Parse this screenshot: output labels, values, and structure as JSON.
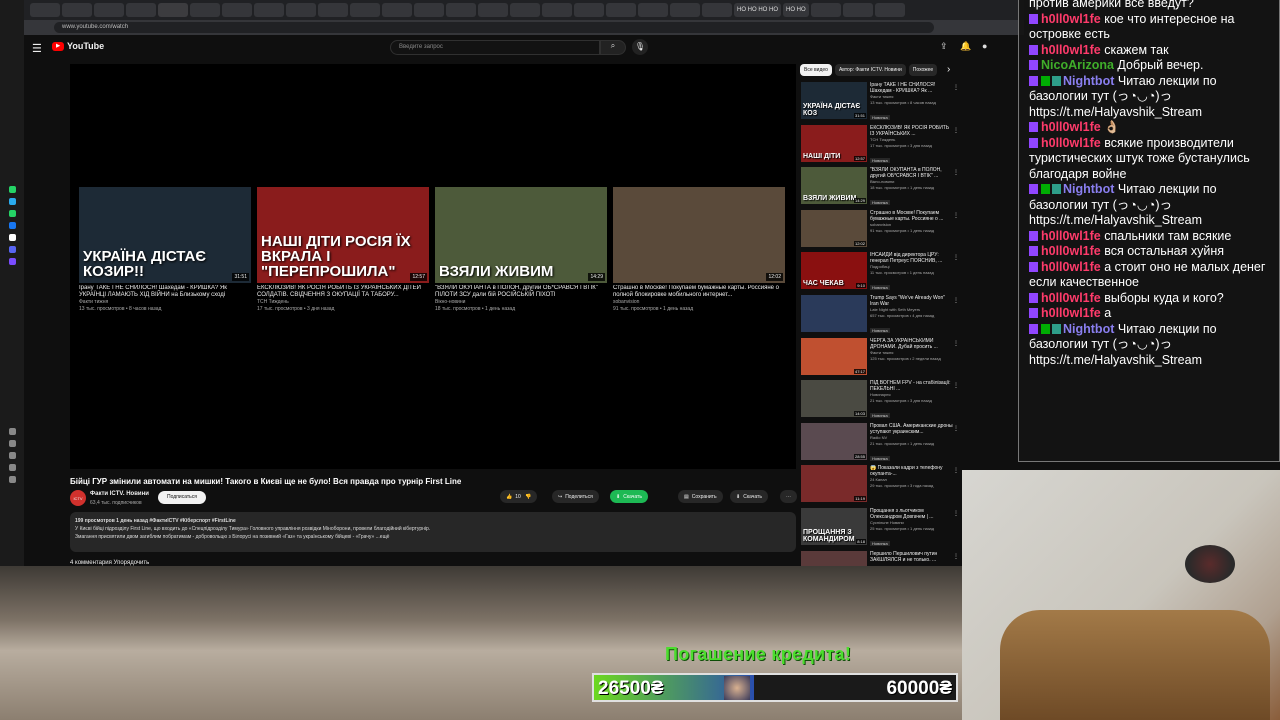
{
  "colors": {
    "bg": "#0f0f0f",
    "accent_red": "#ff0000",
    "chat_purple": "#9146ff",
    "credit_green": "#4cdd2e"
  },
  "browser": {
    "tabs": [
      "",
      "",
      "",
      "",
      "",
      "",
      "",
      "",
      "",
      "",
      "",
      "",
      "",
      "",
      "",
      "",
      "",
      "",
      "",
      "",
      "",
      "",
      "НО НО НО НО",
      "НО НО",
      "",
      "",
      ""
    ],
    "url": "www.youtube.com/watch"
  },
  "youtube": {
    "logo": "YouTube",
    "search_placeholder": "Введите запрос",
    "player_recs": [
      {
        "big": "УКРАЇНА ДІСТАЄ КОЗИР!!",
        "duration": "31:51",
        "title": "Ірану ТАКЕ І НЕ СНИЛОСЯ! Шахедам - КРИШКА? Як УКРАЇНЦІ ЛАМАЮТЬ ХІД ВІЙНИ на Близькому сході",
        "channel": "Факти тижня",
        "meta": "13 тыс. просмотров • 8 часов назад",
        "color": "#1d2a36"
      },
      {
        "big": "НАШІ ДІТИ РОСІЯ ЇХ ВКРАЛА І \"ПЕРЕПРОШИЛА\"",
        "duration": "12:57",
        "title": "ЕКСКЛЮЗИВ! ЯК РОСІЯ РОБИТЬ ІЗ УКРАЇНСЬКИХ ДІТЕЙ СОЛДАТІВ. СВІДЧЕННЯ З ОКУПАЦІЇ ТА ТАБОРУ...",
        "channel": "ТСН Тиждень",
        "meta": "17 тыс. просмотров • 3 дня назад",
        "color": "#8a1c1c"
      },
      {
        "big": "ВЗЯЛИ ЖИВИМ",
        "duration": "14:29",
        "title": "\"ВЗЯЛИ ОКУПАНТА в ПОЛОН, другий ОБ*СРАВСЯ І ВТІК\" ПІЛОТИ ЗСУ дали бій РОСІЙСЬКІЙ ПІХОТІ",
        "channel": "Вікно-новини",
        "meta": "18 тыс. просмотров • 1 день назад",
        "color": "#4d5a3a"
      },
      {
        "big": "",
        "duration": "12:02",
        "title": "Страшно в Москве! Покупаем бумажные карты. Россияне о полной блокировке мобильного интернет...",
        "channel": "sobanvision",
        "meta": "91 тыс. просмотров • 1 день назад",
        "color": "#5a4a3a"
      }
    ],
    "video_title": "Бійці ГУР змінили автомати на мишки! Такого в Києві ще не було! Вся правда про турнір First Line",
    "channel_name": "Факти ICTV. Новини",
    "channel_subs": "63,4 тыс. подписчиков",
    "subscribe": "Подписаться",
    "likes": "10",
    "share": "Поделиться",
    "download_green": "Скачать",
    "save": "Сохранить",
    "download": "Скачать",
    "desc_lines": [
      "199 просмотров  1 день назад  #ФактиICTV #Кіберспорт #FirstLine",
      "У Києві бійці підрозділу First Line, що входить до «Спецпідрозділу Тимура» Головного управління розвідки Міноборони, провели благодійний кібертурнір.",
      "",
      "Змагання присвятили двом загиблим побратимам - добровольцю з Білорусі на позивний «Газ» та українському бійцеві - «Грачу»  ...ещё"
    ],
    "comments": "4 комментария     Упорядочить",
    "chips": [
      "Все видео",
      "Автор: Факти ICTV. Новини",
      "Похожее"
    ],
    "sidebar": [
      {
        "big": "УКРАЇНА ДІСТАЄ КОЗ",
        "duration": "31:51",
        "title": "Ірану ТАКЕ І НЕ СНИЛОСЯ! Шахедам - КРИШКА? Як ...",
        "channel": "Факти тижня",
        "meta": "13 тыс. просмотров • 8 часов назад",
        "badge": "Новинка",
        "color": "#1d2a36"
      },
      {
        "big": "НАШІ ДІТИ",
        "duration": "12:57",
        "title": "ЕКСКЛЮЗИВ! ЯК РОСІЯ РОБИТЬ ІЗ УКРАЇНСЬКИХ ...",
        "channel": "ТСН Тиждень",
        "meta": "17 тыс. просмотров • 3 дня назад",
        "badge": "Новинка",
        "color": "#8a1c1c"
      },
      {
        "big": "ВЗЯЛИ ЖИВИМ",
        "duration": "14:29",
        "title": "\"ВЗЯЛИ ОКУПАНТА в ПОЛОН, другий ОБ*СРАВСЯ І ВТІК\" ...",
        "channel": "Вікно-новини",
        "meta": "18 тыс. просмотров • 1 день назад",
        "badge": "Новинка",
        "color": "#4d5a3a"
      },
      {
        "big": "",
        "duration": "12:02",
        "title": "Страшно в Москве! Покупаем бумажные карты. Россияне о ...",
        "channel": "sobanvision",
        "meta": "91 тыс. просмотров • 1 день назад",
        "badge": "",
        "color": "#5a4a3a"
      },
      {
        "big": "ЧАС ЧЕКАВ",
        "duration": "9:10",
        "title": "ІНСАЙДИ від директора ЦРУ: генерал Петреус ПОЯСНИВ, ...",
        "channel": "Подробиці",
        "meta": "11 тыс. просмотров • 1 день назад",
        "badge": "Новинка",
        "color": "#8a1010"
      },
      {
        "big": "",
        "duration": "",
        "title": "Trump Says \"We've Already Won\" Iran War",
        "channel": "Late Night with Seth Meyers",
        "meta": "657 тыс. просмотров • 4 дня назад",
        "badge": "Новинка",
        "color": "#2a3a5a"
      },
      {
        "big": "",
        "duration": "47:17",
        "title": "ЧЕРГА ЗА УКРАЇНСЬКИМИ ДРОНАМИ. Дубай просить ...",
        "channel": "Факти тижня",
        "meta": "125 тыс. просмотров • 2 недели назад",
        "badge": "",
        "color": "#c05030"
      },
      {
        "big": "",
        "duration": "14:03",
        "title": "ПІД ВОГНЕМ FPV - на стабілізації: ПЕКЕЛЬНІ ...",
        "channel": "Новинарня",
        "meta": "21 тыс. просмотров • 3 дня назад",
        "badge": "Новинка",
        "color": "#4a4a42"
      },
      {
        "big": "",
        "duration": "28:55",
        "title": "Провал США. Американские дроны уступают украинским...",
        "channel": "Radio NV",
        "meta": "21 тыс. просмотров • 1 день назад",
        "badge": "Новинка",
        "color": "#5a4a50"
      },
      {
        "big": "",
        "duration": "11:19",
        "title": "😱 Показали кадри з телефону окупанта-...",
        "channel": "24 Канал",
        "meta": "29 тыс. просмотров • 3 года назад",
        "badge": "",
        "color": "#7a2a2a"
      },
      {
        "big": "ПРОЩАННЯ З КОМАНДИРОМ",
        "duration": "8:18",
        "title": "Прощання з льотчиком Олександром Довгачем | ...",
        "channel": "Суспільне Новини",
        "meta": "25 тыс. просмотров • 1 день назад",
        "badge": "Новинка",
        "color": "#3a3a3a"
      },
      {
        "big": "",
        "duration": "",
        "title": "Першило Першилович путин ЗАКШЛЯЛСЯ и не только. ...",
        "channel": "",
        "meta": "",
        "badge": "",
        "color": "#5a3a3a"
      }
    ]
  },
  "chat": [
    {
      "user": "",
      "color": "#ffffff",
      "text": "против америки все введут?",
      "icon": false,
      "bot": false
    },
    {
      "user": "h0ll0wl1fe",
      "color": "#ff3b6b",
      "text": "кое что интересное на островке есть",
      "icon": true,
      "bot": false
    },
    {
      "user": "h0ll0wl1fe",
      "color": "#ff3b6b",
      "text": "скажем так",
      "icon": true,
      "bot": false
    },
    {
      "user": "NicoArizona",
      "color": "#3fae2a",
      "text": "Добрый вечер.",
      "icon": true,
      "bot": false
    },
    {
      "user": "Nightbot",
      "color": "#8a7ff0",
      "text": "Читаю лекции по базологии тут (っ◔◡◔)っ https://t.me/Halyavshik_Stream",
      "icon": true,
      "bot": true
    },
    {
      "user": "h0ll0wl1fe",
      "color": "#ff3b6b",
      "text": "👌🏼",
      "icon": true,
      "bot": false
    },
    {
      "user": "h0ll0wl1fe",
      "color": "#ff3b6b",
      "text": "всякие производители туристических штук тоже бустанулись благодаря войне",
      "icon": true,
      "bot": false
    },
    {
      "user": "Nightbot",
      "color": "#8a7ff0",
      "text": "Читаю лекции по базологии тут (っ◔◡◔)っ https://t.me/Halyavshik_Stream",
      "icon": true,
      "bot": true
    },
    {
      "user": "h0ll0wl1fe",
      "color": "#ff3b6b",
      "text": "спальники там всякие",
      "icon": true,
      "bot": false
    },
    {
      "user": "h0ll0wl1fe",
      "color": "#ff3b6b",
      "text": "вся остальная хуйня",
      "icon": true,
      "bot": false
    },
    {
      "user": "h0ll0wl1fe",
      "color": "#ff3b6b",
      "text": "а стоит оно не малых денег если качественное",
      "icon": true,
      "bot": false
    },
    {
      "user": "h0ll0wl1fe",
      "color": "#ff3b6b",
      "text": "выборы куда и кого?",
      "icon": true,
      "bot": false
    },
    {
      "user": "h0ll0wl1fe",
      "color": "#ff3b6b",
      "text": "а",
      "icon": true,
      "bot": false
    },
    {
      "user": "Nightbot",
      "color": "#8a7ff0",
      "text": "Читаю лекции по базологии тут (っ◔◡◔)っ https://t.me/Halyavshik_Stream",
      "icon": true,
      "bot": true
    }
  ],
  "credit": {
    "label": "Погашение кредита!",
    "current": "26500₴",
    "goal": "60000₴",
    "progress_fraction": 0.4417
  }
}
